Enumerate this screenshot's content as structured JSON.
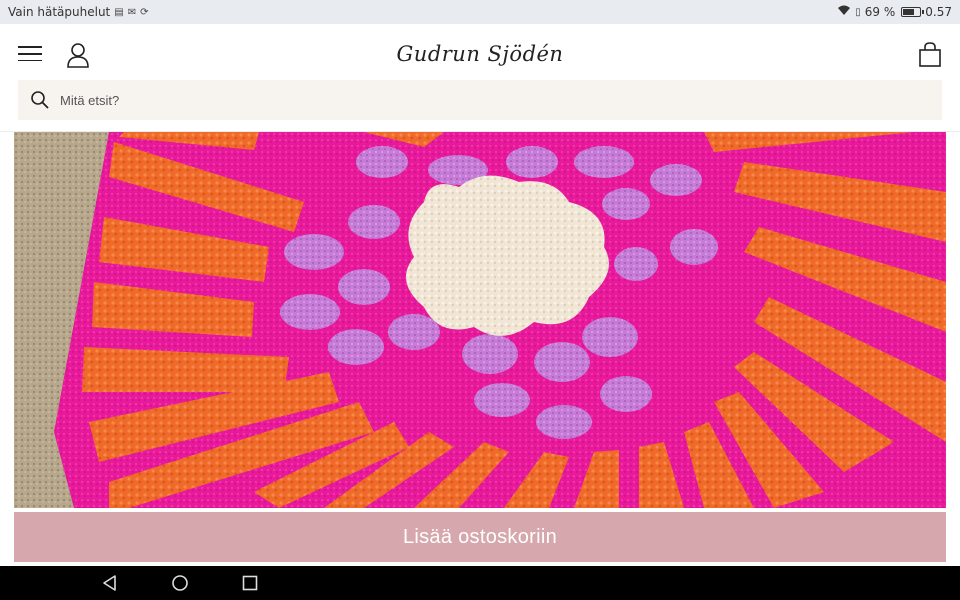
{
  "status_bar": {
    "carrier": "Vain hätäpuhelut",
    "battery_percent": "69 %",
    "battery_level": 0.69,
    "time": "0.57",
    "icons": [
      "sim-card-icon",
      "gmail-icon",
      "sync-icon",
      "wifi-icon",
      "sim-icon",
      "battery-icon"
    ]
  },
  "header": {
    "logo_text": "Gudrun Sjödén",
    "menu_icon": "hamburger-menu-icon",
    "account_icon": "user-icon",
    "cart_icon": "shopping-bag-icon"
  },
  "search": {
    "placeholder": "Mitä etsit?",
    "value": "",
    "icon": "search-icon"
  },
  "product": {
    "image_subject": "rug-image",
    "add_to_cart_label": "Lisää ostoskoriin",
    "add_to_cart_color": "#d6a8ad"
  },
  "colors": {
    "rug_pink": "#e8199a",
    "rug_orange": "#f06a2a",
    "rug_lilac": "#c67bd6",
    "rug_cream": "#f1e6d6"
  },
  "nav_bar": {
    "icons": [
      "back-icon",
      "home-icon",
      "recents-icon"
    ]
  }
}
